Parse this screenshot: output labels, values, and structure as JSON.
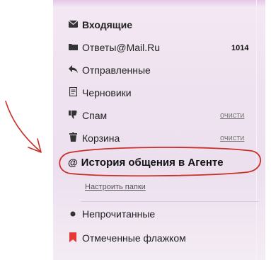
{
  "folders": {
    "inbox": {
      "label": "Входящие",
      "icon": "envelope-icon"
    },
    "replies": {
      "label": "Ответы@Mail.Ru",
      "icon": "folder-icon",
      "count": "1014"
    },
    "sent": {
      "label": "Отправленные",
      "icon": "reply-arrow-icon"
    },
    "drafts": {
      "label": "Черновики",
      "icon": "draft-icon"
    },
    "spam": {
      "label": "Спам",
      "icon": "thumb-down-icon",
      "action": "очисти"
    },
    "trash": {
      "label": "Корзина",
      "icon": "trash-icon",
      "action": "очисти"
    },
    "agent_history": {
      "label": "История общения в Агенте",
      "icon": "at-icon"
    }
  },
  "settings_link": "Настроить папки",
  "filters": {
    "unread": {
      "label": "Непрочитанные",
      "icon": "dot-icon"
    },
    "flagged": {
      "label": "Отмеченные флажком",
      "icon": "flag-icon",
      "icon_color": "#e53935"
    }
  },
  "annotation": {
    "color": "#c8302a"
  }
}
